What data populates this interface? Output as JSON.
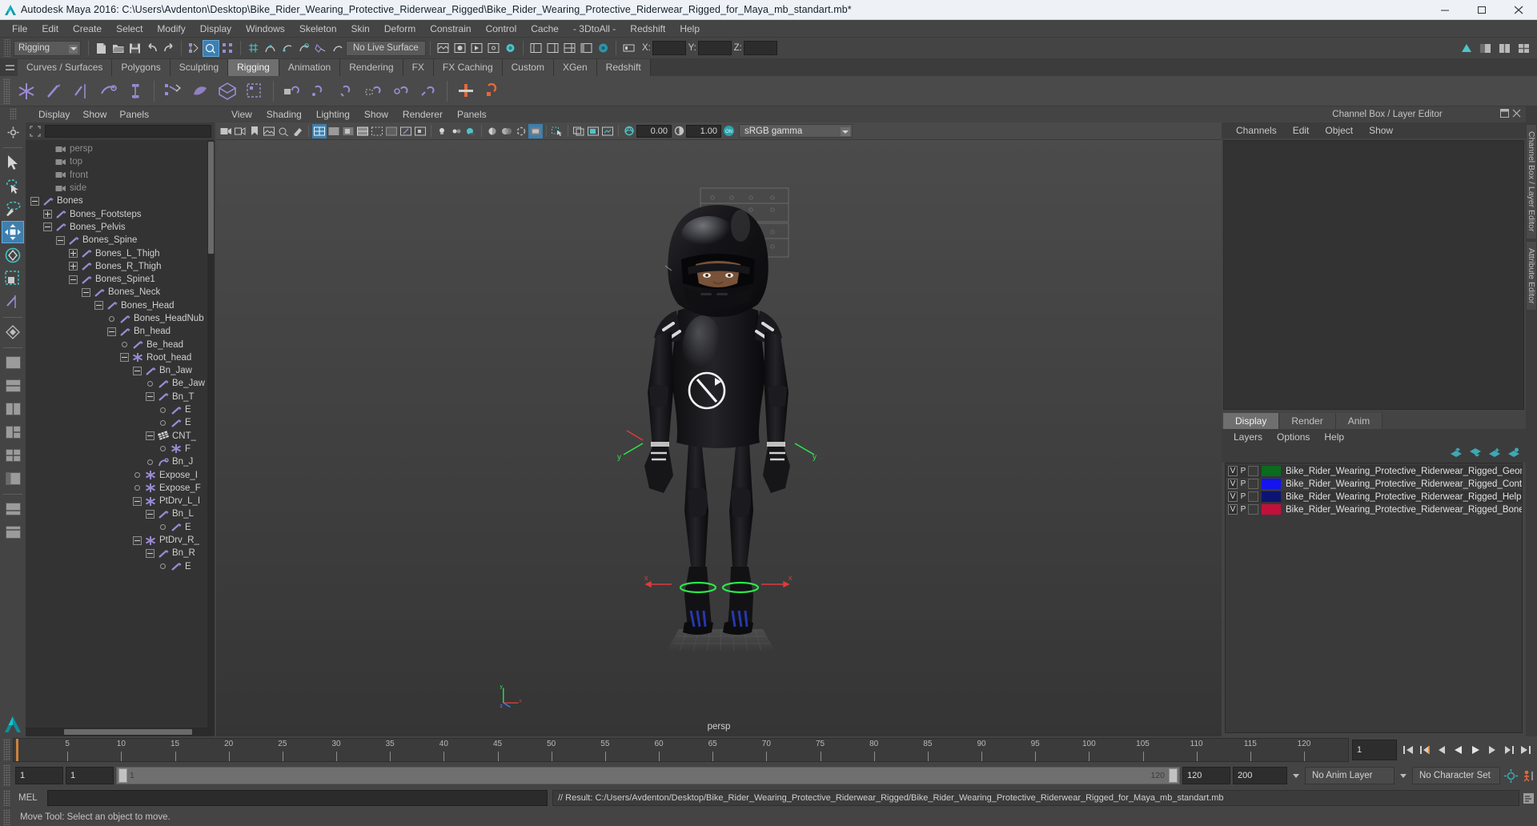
{
  "window": {
    "title": "Autodesk Maya 2016: C:\\Users\\Avdenton\\Desktop\\Bike_Rider_Wearing_Protective_Riderwear_Rigged\\Bike_Rider_Wearing_Protective_Riderwear_Rigged_for_Maya_mb_standart.mb*",
    "minimize": "–",
    "maximize": "□",
    "close": "✕"
  },
  "menubar": [
    "File",
    "Edit",
    "Create",
    "Select",
    "Modify",
    "Display",
    "Windows",
    "Skeleton",
    "Skin",
    "Deform",
    "Constrain",
    "Control",
    "Cache",
    "- 3DtoAll -",
    "Redshift",
    "Help"
  ],
  "statusline": {
    "menu_set": "Rigging",
    "live_surface": "No Live Surface",
    "coords": [
      {
        "label": "X:",
        "value": ""
      },
      {
        "label": "Y:",
        "value": ""
      },
      {
        "label": "Z:",
        "value": ""
      }
    ]
  },
  "shelf": {
    "tabs": [
      "Curves / Surfaces",
      "Polygons",
      "Sculpting",
      "Rigging",
      "Animation",
      "Rendering",
      "FX",
      "FX Caching",
      "Custom",
      "XGen",
      "Redshift"
    ],
    "selected_tab": "Rigging"
  },
  "outliner": {
    "menus": [
      "Display",
      "Show",
      "Panels"
    ],
    "search_value": "",
    "tree": [
      {
        "label": "persp",
        "depth": 1,
        "toggle": "none",
        "icon": "camera-icon",
        "dim": true
      },
      {
        "label": "top",
        "depth": 1,
        "toggle": "none",
        "icon": "camera-icon",
        "dim": true
      },
      {
        "label": "front",
        "depth": 1,
        "toggle": "none",
        "icon": "camera-icon",
        "dim": true
      },
      {
        "label": "side",
        "depth": 1,
        "toggle": "none",
        "icon": "camera-icon",
        "dim": true
      },
      {
        "label": "Bones",
        "depth": 0,
        "toggle": "minus",
        "icon": "joint-icon",
        "dim": false
      },
      {
        "label": "Bones_Footsteps",
        "depth": 1,
        "toggle": "plus",
        "icon": "joint-icon",
        "dim": false
      },
      {
        "label": "Bones_Pelvis",
        "depth": 1,
        "toggle": "minus",
        "icon": "joint-icon",
        "dim": false
      },
      {
        "label": "Bones_Spine",
        "depth": 2,
        "toggle": "minus",
        "icon": "joint-icon",
        "dim": false
      },
      {
        "label": "Bones_L_Thigh",
        "depth": 3,
        "toggle": "plus",
        "icon": "joint-icon",
        "dim": false
      },
      {
        "label": "Bones_R_Thigh",
        "depth": 3,
        "toggle": "plus",
        "icon": "joint-icon",
        "dim": false
      },
      {
        "label": "Bones_Spine1",
        "depth": 3,
        "toggle": "minus",
        "icon": "joint-icon",
        "dim": false
      },
      {
        "label": "Bones_Neck",
        "depth": 4,
        "toggle": "minus",
        "icon": "joint-icon",
        "dim": false
      },
      {
        "label": "Bones_Head",
        "depth": 5,
        "toggle": "minus",
        "icon": "joint-icon",
        "dim": false
      },
      {
        "label": "Bones_HeadNub",
        "depth": 6,
        "toggle": "dot",
        "icon": "joint-icon",
        "dim": false
      },
      {
        "label": "Bn_head",
        "depth": 6,
        "toggle": "minus",
        "icon": "joint-icon",
        "dim": false
      },
      {
        "label": "Be_head",
        "depth": 7,
        "toggle": "dot",
        "icon": "joint-icon",
        "dim": false
      },
      {
        "label": "Root_head",
        "depth": 7,
        "toggle": "minus",
        "icon": "locator-icon",
        "dim": false
      },
      {
        "label": "Bn_Jaw",
        "depth": 8,
        "toggle": "minus",
        "icon": "joint-icon",
        "dim": false
      },
      {
        "label": "Be_Jaw",
        "depth": 9,
        "toggle": "dot",
        "icon": "joint-icon",
        "dim": false
      },
      {
        "label": "Bn_T",
        "depth": 9,
        "toggle": "minus",
        "icon": "joint-icon",
        "dim": false
      },
      {
        "label": "E",
        "depth": 10,
        "toggle": "dot",
        "icon": "joint-icon",
        "dim": false
      },
      {
        "label": "E",
        "depth": 10,
        "toggle": "dot",
        "icon": "joint-icon",
        "dim": false
      },
      {
        "label": "CNT_",
        "depth": 9,
        "toggle": "minus",
        "icon": "mesh-icon",
        "dim": false
      },
      {
        "label": "F",
        "depth": 10,
        "toggle": "dot",
        "icon": "locator-icon",
        "dim": false
      },
      {
        "label": "Bn_J",
        "depth": 9,
        "toggle": "dot",
        "icon": "curve-icon",
        "dim": false
      },
      {
        "label": "Expose_I",
        "depth": 8,
        "toggle": "dot",
        "icon": "locator-icon",
        "dim": false
      },
      {
        "label": "Expose_F",
        "depth": 8,
        "toggle": "dot",
        "icon": "locator-icon",
        "dim": false
      },
      {
        "label": "PtDrv_L_I",
        "depth": 8,
        "toggle": "minus",
        "icon": "locator-icon",
        "dim": false
      },
      {
        "label": "Bn_L",
        "depth": 9,
        "toggle": "minus",
        "icon": "joint-icon",
        "dim": false
      },
      {
        "label": "E",
        "depth": 10,
        "toggle": "dot",
        "icon": "joint-icon",
        "dim": false
      },
      {
        "label": "PtDrv_R_",
        "depth": 8,
        "toggle": "minus",
        "icon": "locator-icon",
        "dim": false
      },
      {
        "label": "Bn_R",
        "depth": 9,
        "toggle": "minus",
        "icon": "joint-icon",
        "dim": false
      },
      {
        "label": "E",
        "depth": 10,
        "toggle": "dot",
        "icon": "joint-icon",
        "dim": false
      }
    ]
  },
  "viewport": {
    "menus": [
      "View",
      "Shading",
      "Lighting",
      "Show",
      "Renderer",
      "Panels"
    ],
    "exposure_value": "0.00",
    "gamma_value": "1.00",
    "color_profile": "sRGB gamma",
    "panel_label": "persp",
    "axis": {
      "x": "x",
      "y": "y",
      "z": "z"
    }
  },
  "channelbox": {
    "title": "Channel Box / Layer Editor",
    "menus": [
      "Channels",
      "Edit",
      "Object",
      "Show"
    ]
  },
  "layer_editor": {
    "tabs": [
      "Display",
      "Render",
      "Anim"
    ],
    "selected_tab": "Display",
    "menus": [
      "Layers",
      "Options",
      "Help"
    ],
    "columns": [
      "V",
      "P",
      ""
    ],
    "layers": [
      {
        "visible": "V",
        "playback": "P",
        "state": "",
        "color": "#0b6b1e",
        "name": "Bike_Rider_Wearing_Protective_Riderwear_Rigged_Geom"
      },
      {
        "visible": "V",
        "playback": "P",
        "state": "",
        "color": "#1414f0",
        "name": "Bike_Rider_Wearing_Protective_Riderwear_Rigged_Contr"
      },
      {
        "visible": "V",
        "playback": "P",
        "state": "",
        "color": "#0b1470",
        "name": "Bike_Rider_Wearing_Protective_Riderwear_Rigged_Helpe"
      },
      {
        "visible": "V",
        "playback": "P",
        "state": "",
        "color": "#c2103c",
        "name": "Bike_Rider_Wearing_Protective_Riderwear_Rigged_Bones"
      }
    ]
  },
  "vertical_tabs": [
    "Channel Box / Layer Editor",
    "Attribute Editor"
  ],
  "timeline": {
    "tick_labels": [
      "5",
      "10",
      "15",
      "20",
      "25",
      "30",
      "35",
      "40",
      "45",
      "50",
      "55",
      "60",
      "65",
      "70",
      "75",
      "80",
      "85",
      "90",
      "95",
      "100",
      "105",
      "110",
      "115",
      "120"
    ],
    "current_frame": "1",
    "start_visible": "1",
    "end_visible": "120"
  },
  "rangeslider": {
    "anim_start": "1",
    "range_start": "1",
    "bar_start_label": "1",
    "bar_end_label": "120",
    "range_end": "120",
    "anim_end": "200",
    "anim_layer": "No Anim Layer",
    "character_set": "No Character Set"
  },
  "commandline": {
    "mel_label": "MEL",
    "input_value": "",
    "output": "// Result: C:/Users/Avdenton/Desktop/Bike_Rider_Wearing_Protective_Riderwear_Rigged/Bike_Rider_Wearing_Protective_Riderwear_Rigged_for_Maya_mb_standart.mb"
  },
  "helpline": {
    "text": "Move Tool: Select an object to move."
  },
  "colors": {
    "accent_blue": "#3e7fad",
    "panel_bg": "#444444",
    "outliner_bg": "#333333",
    "joint_purple": "#9b8bd4",
    "title_bg": "#eef2f7",
    "playhead": "#d3873c"
  }
}
